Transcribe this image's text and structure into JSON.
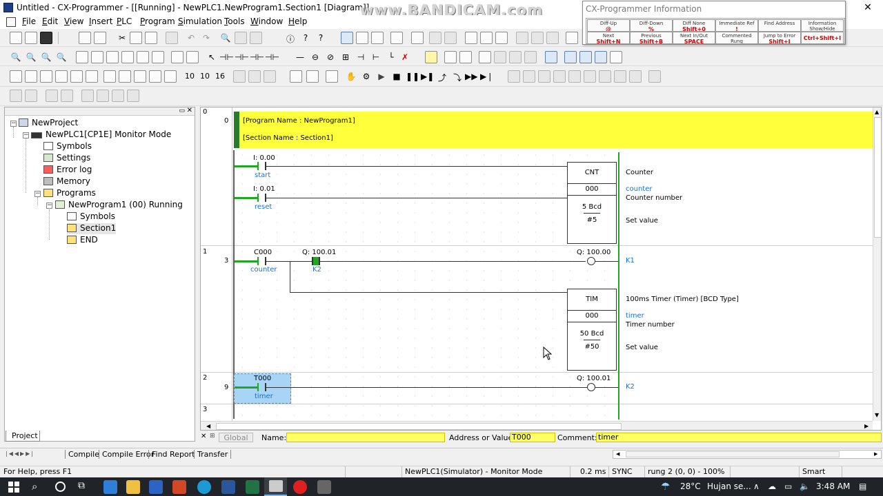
{
  "window": {
    "title": "Untitled - CX-Programmer - [[Running] - NewPLC1.NewProgram1.Section1 [Diagram]]",
    "controls": [
      "—",
      "☐",
      "✕"
    ]
  },
  "watermark": "www.BANDICAM.com",
  "menu": [
    "File",
    "Edit",
    "View",
    "Insert",
    "PLC",
    "Program",
    "Simulation",
    "Tools",
    "Window",
    "Help"
  ],
  "info_popup": {
    "title": "CX-Programmer Information",
    "row1": [
      {
        "caption": "Diff-Up",
        "key": "@"
      },
      {
        "caption": "Diff-Down",
        "key": "%"
      },
      {
        "caption": "Diff None",
        "key": "Shift+0"
      },
      {
        "caption": "Immediate Ref",
        "key": "!"
      },
      {
        "caption": "Information Show/Hide",
        "key": ""
      }
    ],
    "row2": [
      {
        "caption": "Next",
        "key": "Shift+N"
      },
      {
        "caption": "Previous",
        "key": "Shift+B"
      },
      {
        "caption": "Next In/Out",
        "key": "SPACE"
      },
      {
        "caption": "Commented Rung",
        "key": "Shift+L"
      },
      {
        "caption": "Jump to Error",
        "key": "Shift+J"
      },
      {
        "caption": "",
        "key": "Ctrl+Shift+I"
      }
    ],
    "find_address": "Find Address"
  },
  "project_tree": {
    "root": "NewProject",
    "plc": "NewPLC1[CP1E] Monitor Mode",
    "items": [
      "Symbols",
      "Settings",
      "Error log",
      "Memory",
      "Programs"
    ],
    "program": "NewProgram1 (00) Running",
    "program_items": [
      "Symbols",
      "Section1",
      "END"
    ],
    "tab": "Project"
  },
  "ladder": {
    "header": {
      "program_name": "[Program Name : NewProgram1]",
      "section_name": "[Section Name : Section1]"
    },
    "rungs": [
      {
        "rung": "0",
        "step": "0"
      },
      {
        "rung": "1",
        "step": "3"
      },
      {
        "rung": "2",
        "step": "9"
      },
      {
        "rung": "3",
        "step": ""
      }
    ],
    "rung0": {
      "contact1": {
        "address": "I: 0.00",
        "comment": "start"
      },
      "contact2": {
        "address": "I: 0.01",
        "comment": "reset"
      },
      "cnt_box": {
        "name": "CNT",
        "number": "000",
        "value": "5 Bcd",
        "set": "#5"
      },
      "annot": {
        "title": "Counter",
        "symbol": "counter",
        "number_label": "Counter number",
        "set_label": "Set value"
      }
    },
    "rung1": {
      "contact1": {
        "address": "C000",
        "comment": "counter"
      },
      "contact2": {
        "address": "Q: 100.01",
        "comment": "K2"
      },
      "coil": {
        "address": "Q: 100.00",
        "comment": "K1"
      },
      "tim_box": {
        "name": "TIM",
        "number": "000",
        "value": "50 Bcd",
        "set": "#50"
      },
      "annot": {
        "title": "100ms Timer (Timer) [BCD Type]",
        "symbol": "timer",
        "number_label": "Timer number",
        "set_label": "Set value"
      }
    },
    "rung2": {
      "contact1": {
        "address": "T000",
        "comment": "timer"
      },
      "coil": {
        "address": "Q: 100.01",
        "comment": "K2"
      }
    }
  },
  "info_bar": {
    "close": "✕",
    "global": "Global",
    "name_label": "Name:",
    "name_value": "",
    "address_label": "Address or Value:",
    "address_value": "T000",
    "comment_label": "Comment:",
    "comment_value": "timer"
  },
  "output_tabs": [
    "Compile",
    "Compile Error",
    "Find Report",
    "Transfer"
  ],
  "status": {
    "help": "For Help, press F1",
    "mode": "NewPLC1(Simulator) - Monitor Mode",
    "scan": "0.2 ms",
    "sync": "SYNC",
    "position": "rung 2 (0, 0)  - 100%",
    "smart": "Smart"
  },
  "taskbar": {
    "temperature": "28°C",
    "weather": "Hujan se...",
    "time": "3:48 AM"
  },
  "colors": {
    "header_yellow": "#ffff3c",
    "power_green": "#1ea81e",
    "comment_blue": "#1a6fd6",
    "selection_blue": "#a8d4f6"
  }
}
